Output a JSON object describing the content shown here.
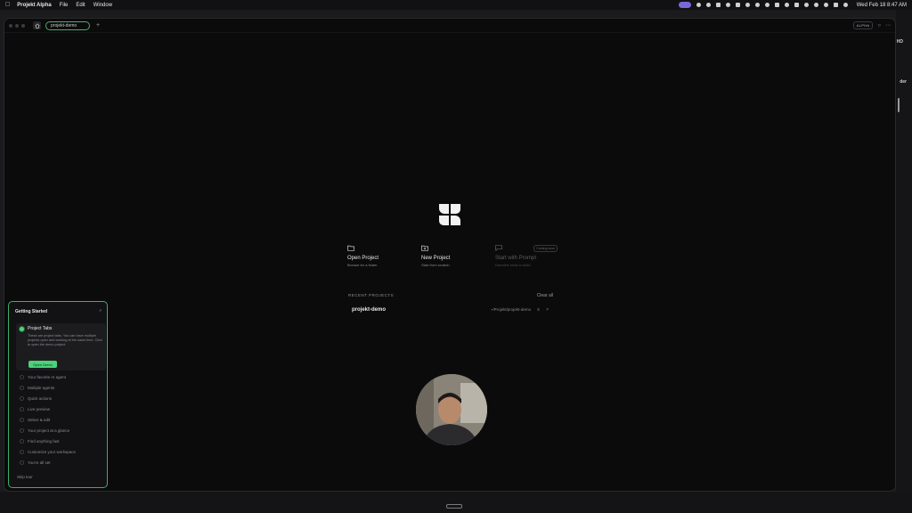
{
  "menubar": {
    "app_name": "Projekt Alpha",
    "menus": [
      "File",
      "Edit",
      "Window"
    ],
    "clock": "Wed Feb 18  8:47 AM"
  },
  "tabbar": {
    "tab_label": "projekt-demo",
    "new_tab": "+",
    "badge": "ALPHA"
  },
  "launcher": {
    "actions": [
      {
        "title": "Open Project",
        "subtitle": "Browse for a folder"
      },
      {
        "title": "New Project",
        "subtitle": "Start from scratch"
      },
      {
        "title": "Start with Prompt",
        "subtitle": "Describe what to build",
        "tag": "Coming soon"
      }
    ],
    "recent": {
      "heading": "RECENT PROJECTS",
      "clear": "Clear all",
      "items": [
        {
          "name": "projekt-demo",
          "path": "~/Projekt/projekt-demo"
        }
      ]
    }
  },
  "getting_started": {
    "title": "Getting Started",
    "active": {
      "title": "Project Tabs",
      "description": "These are project tabs. You can have multiple projects open and working at the same time. Click to open the demo project.",
      "button": "Open Demo"
    },
    "steps": [
      "Your favorite AI agent",
      "Multiple agents",
      "Quick actions",
      "Live preview",
      "Select & edit",
      "Your project at a glance",
      "Find anything fast",
      "Customize your workspace",
      "You're all set"
    ],
    "skip": "Skip tour"
  },
  "desktop": {
    "edge_label_1": "HD",
    "edge_label_2": "der"
  },
  "colors": {
    "accent_green": "#4bd17a",
    "window_bg": "#0b0b0c"
  }
}
